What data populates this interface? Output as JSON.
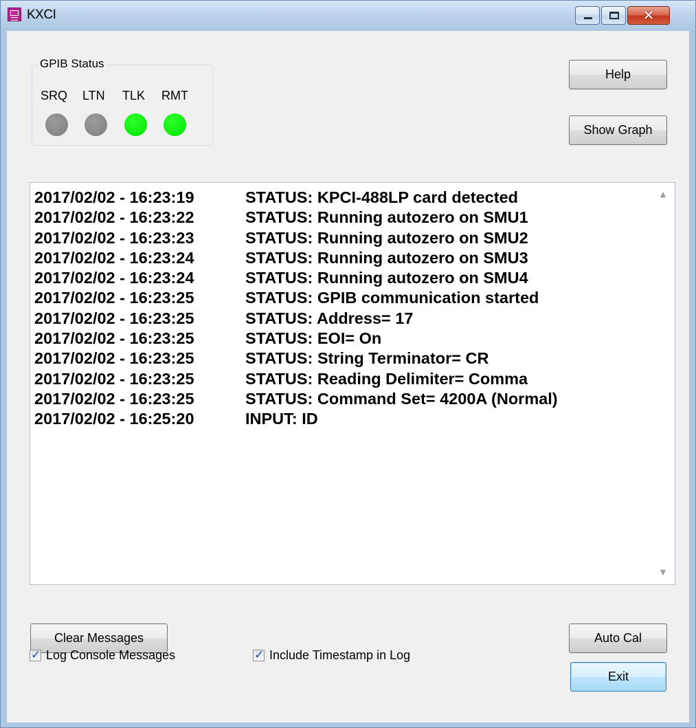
{
  "window": {
    "title": "KXCI"
  },
  "gpib_status": {
    "group_label": "GPIB Status",
    "indicators": [
      {
        "label": "SRQ",
        "state": "off",
        "color": "#8c8c8c"
      },
      {
        "label": "LTN",
        "state": "off",
        "color": "#8c8c8c"
      },
      {
        "label": "TLK",
        "state": "on",
        "color": "#00ee00"
      },
      {
        "label": "RMT",
        "state": "on",
        "color": "#00ee00"
      }
    ]
  },
  "buttons": {
    "help": "Help",
    "show_graph": "Show Graph",
    "clear_messages": "Clear Messages",
    "auto_cal": "Auto Cal",
    "exit": "Exit"
  },
  "log": {
    "lines": [
      {
        "timestamp": "2017/02/02 - 16:23:19",
        "message": "STATUS: KPCI-488LP card detected"
      },
      {
        "timestamp": "2017/02/02 - 16:23:22",
        "message": "STATUS: Running autozero on SMU1"
      },
      {
        "timestamp": "2017/02/02 - 16:23:23",
        "message": "STATUS: Running autozero on SMU2"
      },
      {
        "timestamp": "2017/02/02 - 16:23:24",
        "message": "STATUS: Running autozero on SMU3"
      },
      {
        "timestamp": "2017/02/02 - 16:23:24",
        "message": "STATUS: Running autozero on SMU4"
      },
      {
        "timestamp": "2017/02/02 - 16:23:25",
        "message": "STATUS: GPIB communication started"
      },
      {
        "timestamp": "2017/02/02 - 16:23:25",
        "message": "STATUS: Address= 17"
      },
      {
        "timestamp": "2017/02/02 - 16:23:25",
        "message": "STATUS: EOI= On"
      },
      {
        "timestamp": "2017/02/02 - 16:23:25",
        "message": "STATUS: String Terminator= CR"
      },
      {
        "timestamp": "2017/02/02 - 16:23:25",
        "message": "STATUS: Reading Delimiter= Comma"
      },
      {
        "timestamp": "2017/02/02 - 16:23:25",
        "message": "STATUS: Command Set= 4200A (Normal)"
      },
      {
        "timestamp": "2017/02/02 - 16:25:20",
        "message": "INPUT: ID"
      }
    ]
  },
  "options": {
    "log_console": {
      "label": "Log Console Messages",
      "checked": true
    },
    "include_timestamp": {
      "label": "Include Timestamp in Log",
      "checked": true
    }
  }
}
